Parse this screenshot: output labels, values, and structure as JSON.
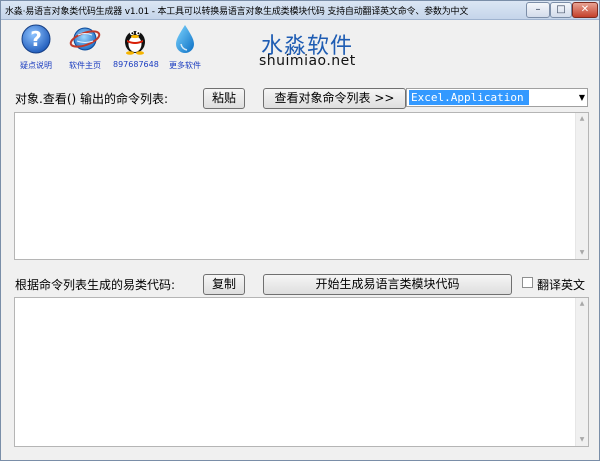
{
  "window": {
    "title": "水淼·易语言对象类代码生成器 v1.01 - 本工具可以转换易语言对象生成类模块代码 支持自动翻译英文命令、参数为中文",
    "minimize": "–",
    "maximize": "□",
    "close": "✕"
  },
  "toolbar": [
    {
      "label": "疑点说明",
      "icon": "help-icon"
    },
    {
      "label": "软件主页",
      "icon": "globe-icon"
    },
    {
      "label": "897687648",
      "icon": "qq-penguin-icon"
    },
    {
      "label": "更多软件",
      "icon": "water-drop-icon"
    }
  ],
  "brand": {
    "name_cn": "水淼软件",
    "name_en": "shuimiao.net"
  },
  "top_section": {
    "label": "对象.查看() 输出的命令列表:",
    "paste_button": "粘贴",
    "view_button": "查看对象命令列表 >>",
    "object_value": "Excel.Application"
  },
  "bottom_section": {
    "label": "根据命令列表生成的易类代码:",
    "copy_button": "复制",
    "generate_button": "开始生成易语言类模块代码",
    "translate_label": "翻译英文"
  },
  "colors": {
    "brand_blue": "#1e5cb3",
    "selection_blue": "#3399ff",
    "link_blue": "#1a3cc0"
  }
}
